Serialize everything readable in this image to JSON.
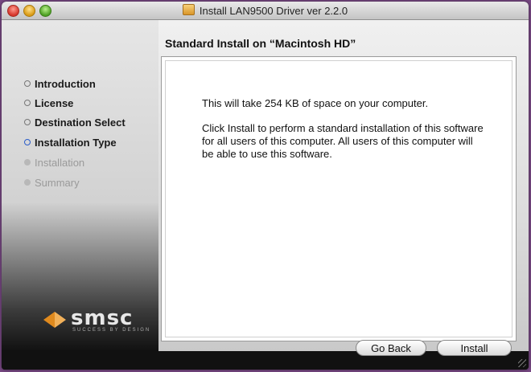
{
  "window": {
    "title": "Install LAN9500 Driver ver 2.2.0"
  },
  "heading": "Standard Install on “Macintosh HD”",
  "steps": [
    {
      "label": "Introduction",
      "state": "done"
    },
    {
      "label": "License",
      "state": "done"
    },
    {
      "label": "Destination Select",
      "state": "done"
    },
    {
      "label": "Installation Type",
      "state": "current"
    },
    {
      "label": "Installation",
      "state": "pending"
    },
    {
      "label": "Summary",
      "state": "pending"
    }
  ],
  "message": {
    "space": "This will take 254 KB of space on your computer.",
    "details": "Click Install to perform a standard installation of this software for all users of this computer. All users of this computer will be able to use this software."
  },
  "buttons": {
    "back": "Go Back",
    "install": "Install"
  },
  "logo": {
    "word": "smsc",
    "tagline": "SUCCESS BY DESIGN"
  },
  "colors": {
    "current_step_bullet": "#2a5cc9",
    "logo_accent": "#e08a1e"
  }
}
